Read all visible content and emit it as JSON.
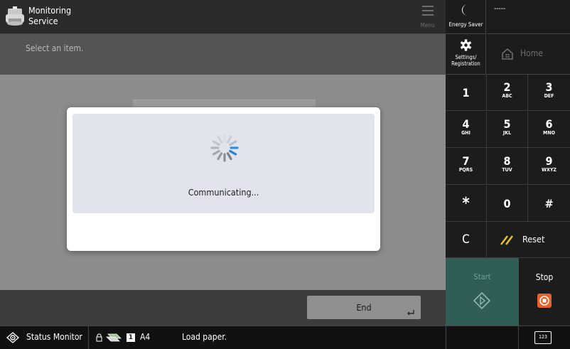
{
  "header": {
    "app_title": "Monitoring\nService",
    "menu_label": "Menu"
  },
  "subheader": {
    "text": "Select an item."
  },
  "dialog": {
    "message": "Communicating..."
  },
  "footer": {
    "end_label": "End"
  },
  "right_panel": {
    "energy_saver_label": "Energy Saver",
    "counter_text": "-----",
    "settings_label": "Settings/\nRegistration",
    "home_label": "Home",
    "keys": [
      {
        "num": "1",
        "sub": ""
      },
      {
        "num": "2",
        "sub": "ABC"
      },
      {
        "num": "3",
        "sub": "DEF"
      },
      {
        "num": "4",
        "sub": "GHI"
      },
      {
        "num": "5",
        "sub": "JKL"
      },
      {
        "num": "6",
        "sub": "MNO"
      },
      {
        "num": "7",
        "sub": "PQRS"
      },
      {
        "num": "8",
        "sub": "TUV"
      },
      {
        "num": "9",
        "sub": "WXYZ"
      },
      {
        "num": "*",
        "sub": ""
      },
      {
        "num": "0",
        "sub": ""
      },
      {
        "num": "#",
        "sub": ""
      }
    ],
    "clear_label": "C",
    "reset_label": "Reset",
    "start_label": "Start",
    "stop_label": "Stop"
  },
  "statusbar": {
    "status_monitor_label": "Status Monitor",
    "tray_number": "1",
    "paper_size": "A4",
    "message": "Load paper.",
    "keyboard_label": "123"
  },
  "colors": {
    "start_bg": "#2f5e57",
    "stop_icon": "#e8612c",
    "reset_icon": "#e5c52a",
    "spinner_accent": "#2f8fd8"
  }
}
